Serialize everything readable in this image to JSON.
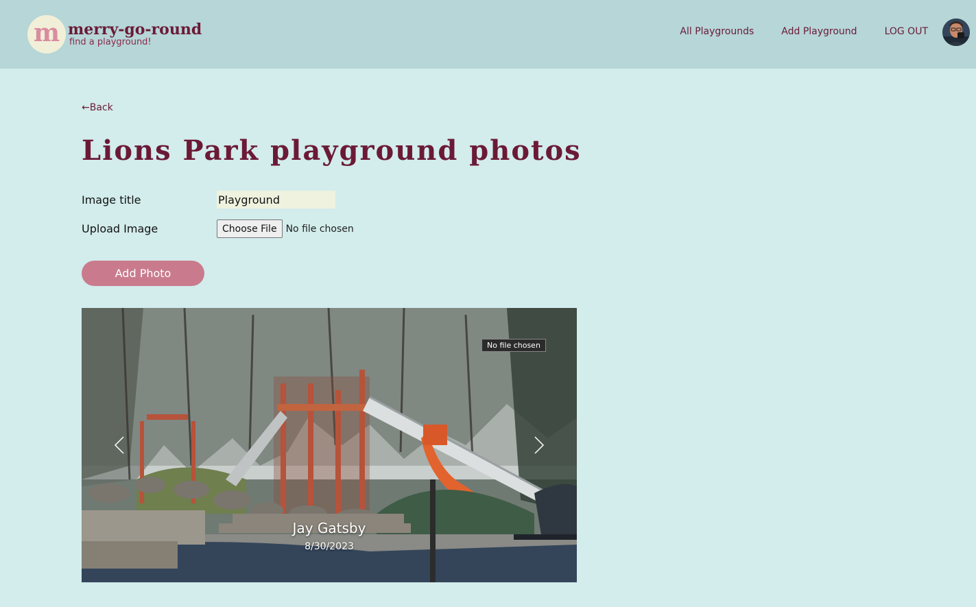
{
  "brand": {
    "logo_letter": "m",
    "name": "merry-go-round",
    "tagline": "find a playground!"
  },
  "nav": {
    "items": [
      "All Playgrounds",
      "Add Playground",
      "LOG OUT"
    ]
  },
  "back_label": "←Back",
  "page_title": "Lions Park playground photos",
  "form": {
    "image_title_label": "Image title",
    "image_title_value": "Playground",
    "upload_label": "Upload Image",
    "choose_file_label": "Choose File",
    "file_status": "No file chosen",
    "submit_label": "Add Photo"
  },
  "carousel": {
    "tooltip": "No file chosen",
    "author": "Jay Gatsby",
    "date": "8/30/2023"
  },
  "colors": {
    "header_bg": "#b6d6d8",
    "page_bg": "#d3ecec",
    "brand": "#6b1a36",
    "button": "#c97b8d"
  },
  "icons": [
    "chevron-left-icon",
    "chevron-right-icon"
  ]
}
